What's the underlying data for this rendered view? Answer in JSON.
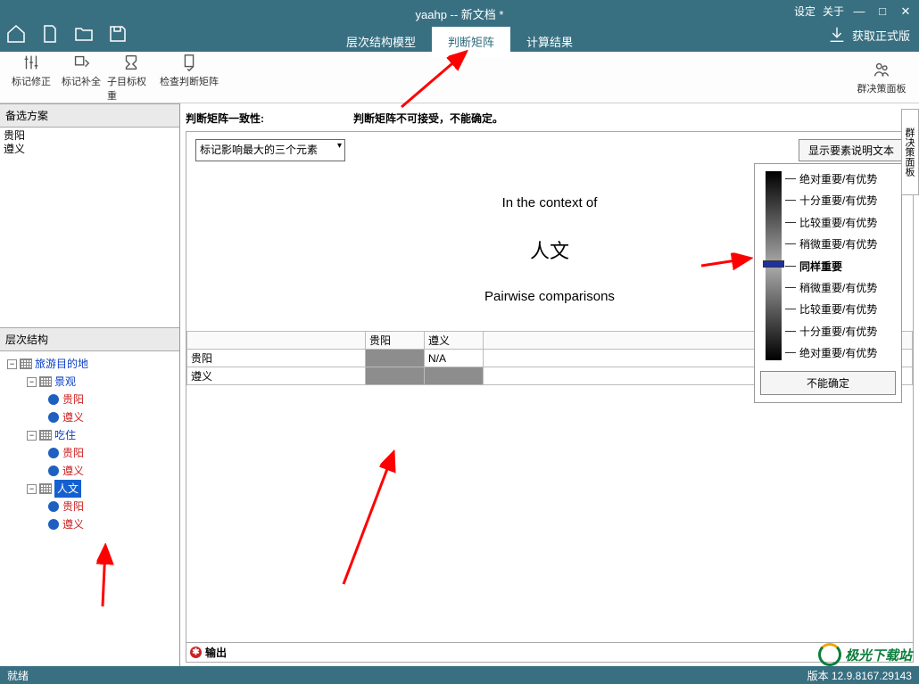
{
  "title": "yaahp -- 新文档 *",
  "titleMenu": {
    "settings": "设定",
    "about": "关于"
  },
  "getFull": "获取正式版",
  "mainTabs": {
    "model": "层次结构模型",
    "matrix": "判断矩阵",
    "result": "计算结果"
  },
  "toolbar": {
    "markFix": "标记修正",
    "markFill": "标记补全",
    "subWeight": "子目标权重",
    "checkMatrix": "检查判断矩阵",
    "groupPanel": "群决策面板"
  },
  "leftPanels": {
    "alt": "备选方案",
    "tree": "层次结构"
  },
  "alts": [
    "贵阳",
    "遵义"
  ],
  "tree": {
    "root": "旅游目的地",
    "c1": "景观",
    "c1a": "贵阳",
    "c1b": "遵义",
    "c2": "吃住",
    "c2a": "贵阳",
    "c2b": "遵义",
    "c3": "人文",
    "c3a": "贵阳",
    "c3b": "遵义"
  },
  "consist": {
    "label": "判断矩阵一致性:",
    "msg": "判断矩阵不可接受，不能确定。"
  },
  "dropdown": "标记影响最大的三个元素",
  "showDesc": "显示要素说明文本",
  "context": {
    "line1": "In the context of",
    "subject": "人文",
    "line2": "Pairwise comparisons"
  },
  "matrix": {
    "cols": [
      "",
      "贵阳",
      "遵义"
    ],
    "r1": {
      "h": "贵阳",
      "c2": "N/A"
    },
    "r2": {
      "h": "遵义"
    }
  },
  "output": "输出",
  "scale": {
    "l1": "绝对重要/有优势",
    "l2": "十分重要/有优势",
    "l3": "比较重要/有优势",
    "l4": "稍微重要/有优势",
    "l5": "同样重要",
    "l6": "稍微重要/有优势",
    "l7": "比较重要/有优势",
    "l8": "十分重要/有优势",
    "l9": "绝对重要/有优势",
    "unsure": "不能确定"
  },
  "sideTab": "群决策面板",
  "status": {
    "left": "就绪",
    "right": "版本 12.9.8167.29143"
  },
  "watermark": "极光下载站"
}
